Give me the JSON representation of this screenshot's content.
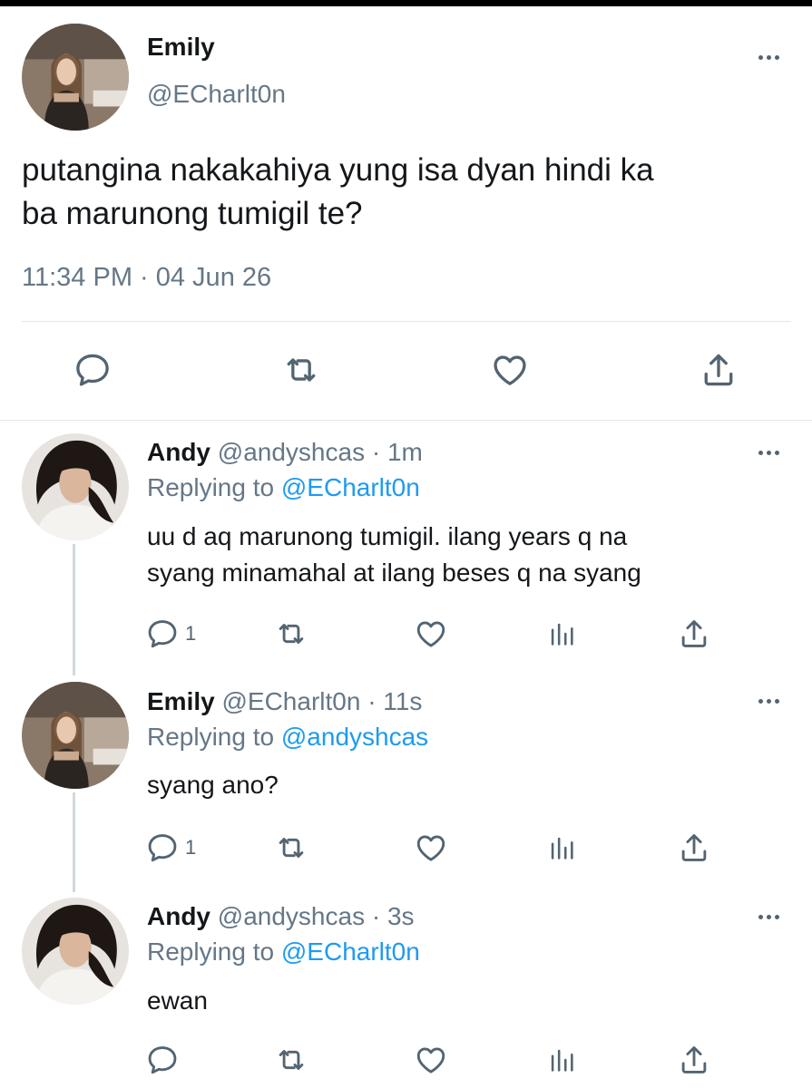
{
  "main_tweet": {
    "author": {
      "name": "Emily",
      "handle": "@ECharlt0n"
    },
    "text_line1": "putangina nakakahiya yung isa dyan hindi ka",
    "text_line2": "ba marunong tumigil te?",
    "timestamp": "11:34 PM · 04 Jun 26",
    "actions": [
      "comment-icon",
      "retweet-icon",
      "like-icon",
      "share-icon"
    ]
  },
  "replies": [
    {
      "name": "Andy",
      "handle_time": "@andyshcas · 1m",
      "replying_prefix": "Replying to",
      "replying_to": "@ECharlt0n",
      "text_line1": "uu d aq marunong tumigil. ilang years q na",
      "text_line2": "syang minamahal at ilang beses q na syang",
      "reply_count": "1"
    },
    {
      "name": "Emily",
      "handle_time": "@ECharlt0n · 11s",
      "replying_prefix": "Replying to",
      "replying_to": "@andyshcas",
      "text_line1": "syang ano?",
      "reply_count": "1"
    },
    {
      "name": "Andy",
      "handle_time": "@andyshcas · 3s",
      "replying_prefix": "Replying to",
      "replying_to": "@ECharlt0n",
      "text_line1": "ewan",
      "reply_count": ""
    }
  ],
  "colors": {
    "link": "#1d9bf0",
    "secondary_text": "#657786",
    "icon": "#536471"
  }
}
